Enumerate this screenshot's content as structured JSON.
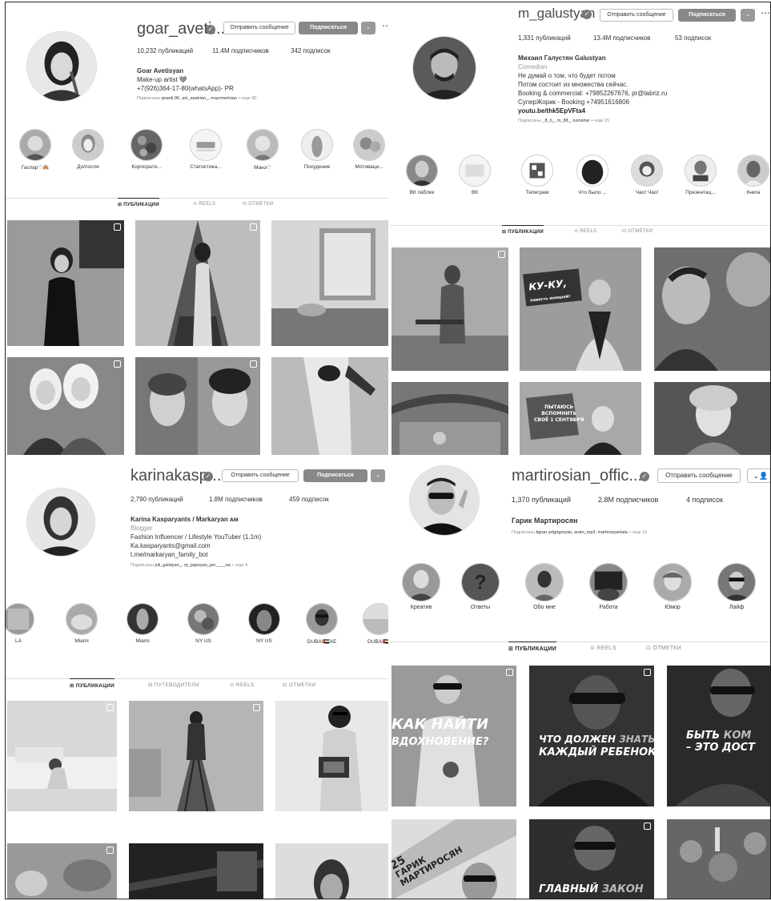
{
  "profiles": {
    "goar": {
      "username": "goar_aveti...",
      "message_btn": "Отправить сообщение",
      "follow_btn": "Подписаться",
      "stats": {
        "posts": "10,232 публикаций",
        "followers": "11.4M подписчиков",
        "following": "342 подписок"
      },
      "bio": {
        "name": "Goar Avetisyan",
        "line1": "Make-up artist 🩶",
        "line2": "+7(926)364-17-80(whatsApp)- PR",
        "followed_by_prefix": "Подписаны",
        "followed_by_names": "qnarik.96, ani_asatrian_, maynmeloian",
        "followed_by_more": "+ еще 30"
      },
      "highlights": [
        "Гаспар♡🙈",
        "До/после",
        "Корпорати...",
        "Статистика...",
        "Манэ♡",
        "Похудение",
        "Мотиваци..."
      ],
      "tabs": [
        "ПУБЛИКАЦИИ",
        "REELS",
        "ОТМЕТКИ"
      ]
    },
    "galustyan": {
      "username": "m_galustyan",
      "message_btn": "Отправить сообщение",
      "follow_btn": "Подписаться",
      "stats": {
        "posts": "1,331 публикаций",
        "followers": "13.4M подписчиков",
        "following": "53 подписок"
      },
      "bio": {
        "name": "Михаил Галустян Galustyan",
        "category": "Comedian",
        "line1": "Не думай о том, что будет потом",
        "line2": "Потом состоит из множества сейчас.",
        "line3": "Booking & commercial: +79852267676, pr@tabriz.ru",
        "line4": "СуперЖорик - Booking +74951616806",
        "link": "youtu.be/thk5EpVFta4",
        "followed_by_prefix": "Подписаны",
        "followed_by_names": "_8_h_, m_88_, lusnshar",
        "followed_by_more": "+ еще 15"
      },
      "highlights": [
        "ВК паблик",
        "ВК",
        "Телеграм",
        "Что было ...",
        "Чао! Чао!",
        "Презентац...",
        "Книга"
      ],
      "tabs": [
        "ПУБЛИКАЦИИ",
        "REELS",
        "ОТМЕТКИ"
      ],
      "post_texts": {
        "p2_line1": "КУ-КУ,",
        "p2_line2": "повесть юношей!",
        "p5_line1": "ПЫТАЮСЬ",
        "p5_line2": "ВСПОМНИТЬ",
        "p5_line3": "СВОЁ 1 СЕНТЯБРЯ"
      }
    },
    "karina": {
      "username": "karinakasp...",
      "message_btn": "Отправить сообщение",
      "follow_btn": "Подписаться",
      "stats": {
        "posts": "2,790 публикаций",
        "followers": "1.8M подписчиков",
        "following": "459 подписок"
      },
      "bio": {
        "name": "Karina Kasparyants / Markaryan ᴀᴍ",
        "category": "Blogger",
        "line1": "Fashion Influencer / Lifestyle YouTuber (1,1m)",
        "line2": "Ka.kasparyants@gmail.com",
        "link": "t.me/markaryan_family_bot",
        "followed_by_prefix": "Подписаны",
        "followed_by_names": "juli_galstyan_, rp_papoyan_jen____na",
        "followed_by_more": "+ еще 4"
      },
      "highlights": [
        "LA",
        "Miami",
        "Miami",
        "NY US",
        "NY US",
        "DUBAI🇦🇪AE",
        "DUBAI🇦🇪"
      ],
      "tabs": [
        "ПУБЛИКАЦИИ",
        "ПУТЕВОДИТЕЛИ",
        "REELS",
        "ОТМЕТКИ"
      ]
    },
    "martirosian": {
      "username": "martirosian_offic...",
      "message_btn": "Отправить сообщение",
      "stats": {
        "posts": "1,370 публикаций",
        "followers": "2.8M подписчиков",
        "following": "4 подписок"
      },
      "bio": {
        "name": "Гарик Мартиросян",
        "followed_by_prefix": "Подписаны",
        "followed_by_names": "tigran.artgrigoryan, aram_mp3, martirosyanlala",
        "followed_by_more": "+ еще 16"
      },
      "highlights": [
        "Креатив",
        "Ответы",
        "Обо мне",
        "Работа",
        "Юмор",
        "Лайф"
      ],
      "tabs": [
        "ПУБЛИКАЦИИ",
        "REELS",
        "ОТМЕТКИ"
      ],
      "post_texts": {
        "p1_line1": "КАК НАЙТИ",
        "p1_line2": "ВДОХНОВЕНИЕ?",
        "p2_line1a": "ЧТО ДОЛЖЕН",
        "p2_line1b": "ЗНАТЬ",
        "p2_line2": "КАЖДЫЙ РЕБЕНОК",
        "p3_line1a": "БЫТЬ",
        "p3_line1b": "КОМ",
        "p3_line2": "– ЭТО ДОСТ",
        "p4_line1": "25",
        "p4_line2": "ГАРИК",
        "p4_line3": "МАРТИРОСЯН",
        "p5_line1a": "ГЛАВНЫЙ",
        "p5_line1b": "ЗАКОН"
      }
    }
  }
}
